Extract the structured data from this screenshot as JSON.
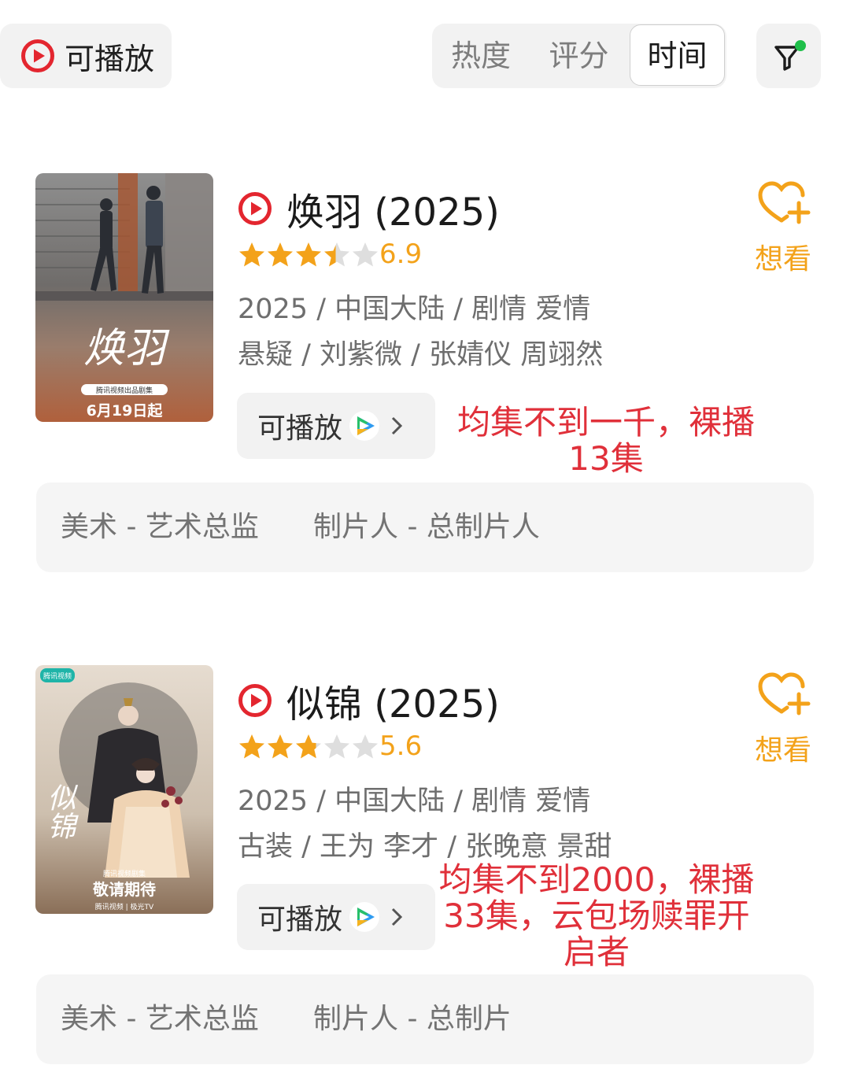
{
  "header": {
    "playable_filter_label": "可播放",
    "sort_tabs": [
      "热度",
      "评分",
      "时间"
    ],
    "active_sort": "时间",
    "filter_has_badge": true
  },
  "colors": {
    "accent_red": "#e3262f",
    "star_gold": "#f3a21a",
    "annotation_red": "#e0303a",
    "badge_green": "#1fbf4a"
  },
  "items": [
    {
      "title": "焕羽 (2025)",
      "rating": 6.9,
      "rating_text": "6.9",
      "star_fill": 0.69,
      "meta_line1": "2025 / 中国大陆 / 剧情 爱情",
      "meta_line2": "悬疑 / 刘紫微 / 张婧仪 周翊然",
      "playable_label": "可播放",
      "wish_label": "想看",
      "annotation": [
        "均集不到一千，裸播",
        "13集"
      ],
      "credits": [
        "美术 - 艺术总监",
        "制片人 - 总制片人"
      ],
      "poster": {
        "calligraphy": "焕羽",
        "studio_line": "腾讯视频出品剧集",
        "date": "6月19日起"
      }
    },
    {
      "title": "似锦 (2025)",
      "rating": 5.6,
      "rating_text": "5.6",
      "star_fill": 0.56,
      "meta_line1": "2025 / 中国大陆 / 剧情 爱情",
      "meta_line2": "古装 / 王为 李才 / 张晚意 景甜",
      "playable_label": "可播放",
      "wish_label": "想看",
      "annotation": [
        "均集不到2000，裸播",
        "33集，云包场赎罪开",
        "启者"
      ],
      "credits": [
        "美术 - 艺术总监",
        "制片人 - 总制片"
      ],
      "poster": {
        "platform": "腾讯视频",
        "calligraphy": "似锦",
        "studio_line": "腾讯视频剧集",
        "tagline": "敬请期待",
        "footer": "腾讯视频 | 极光TV"
      }
    }
  ]
}
